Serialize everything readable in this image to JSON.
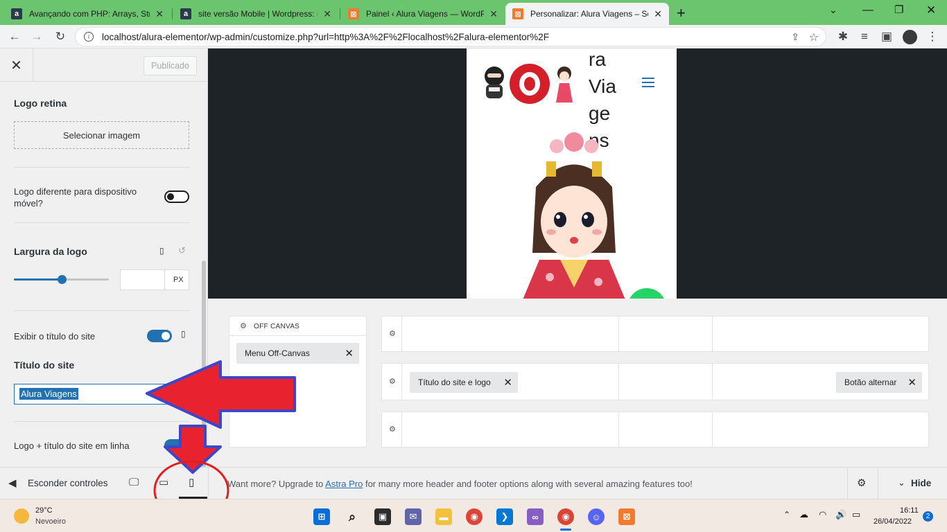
{
  "browser": {
    "tabs": [
      {
        "title": "Avançando com PHP: Arrays, Strin",
        "icon": "alura-icon"
      },
      {
        "title": "site versão Mobile | Wordpress: in",
        "icon": "alura-icon"
      },
      {
        "title": "Painel ‹ Alura Viagens — WordPre",
        "icon": "xampp-icon"
      },
      {
        "title": "Personalizar: Alura Viagens – Só u",
        "icon": "xampp-icon"
      }
    ],
    "url": "localhost/alura-elementor/wp-admin/customize.php?url=http%3A%2F%2Flocalhost%2Falura-elementor%2F"
  },
  "sidebar": {
    "published_label": "Publicado",
    "logo_retina": "Logo retina",
    "select_image": "Selecionar imagem",
    "mobile_logo_label": "Logo diferente para dispositivo móvel?",
    "logo_width": "Largura da logo",
    "logo_width_value": "",
    "unit": "PX",
    "slider_fraction": 0.5,
    "show_title_label": "Exibir o título do site",
    "site_title_label": "Título do site",
    "site_title_value": "Alura Viagens",
    "inline_label": "Logo + título do site em linha"
  },
  "preview": {
    "title_fragments": [
      "ra",
      "Via",
      "ge",
      "ns"
    ]
  },
  "builder": {
    "off_canvas_title": "OFF CANVAS",
    "off_canvas_item": "Menu Off-Canvas",
    "title_logo_chip": "Título do site e logo",
    "toggle_chip": "Botão alternar"
  },
  "footer_bar": {
    "hide_controls": "Esconder controles",
    "upgrade_pre": "Want more? Upgrade to ",
    "upgrade_link": "Astra Pro",
    "upgrade_post": " for many more header and footer options along with several amazing features too!",
    "hide": "Hide"
  },
  "taskbar": {
    "temp": "29°C",
    "weather": "Nevoeiro",
    "time": "16:11",
    "date": "26/04/2022",
    "notifications": "2"
  },
  "colors": {
    "tabbar": "#6bc46e",
    "accent": "#2271b1",
    "arrow_fill": "#e8232f",
    "arrow_outline": "#4046c8",
    "circle": "#e02020"
  }
}
